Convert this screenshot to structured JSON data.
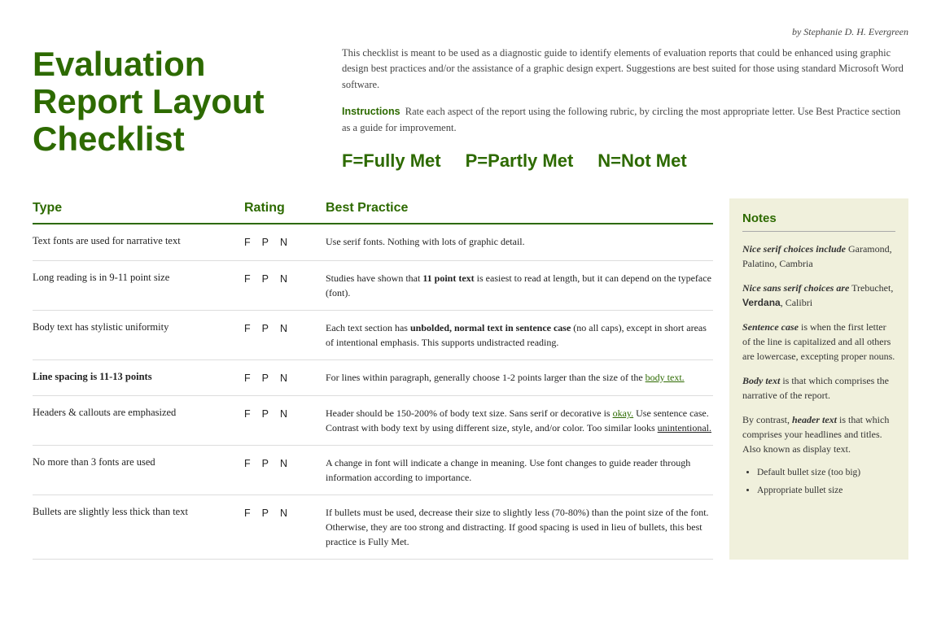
{
  "byline": "by Stephanie D. H. Evergreen",
  "title": {
    "line1": "Evaluation",
    "line2": "Report Layout",
    "line3": "Checklist"
  },
  "intro": {
    "description": "This checklist is meant to be used as a diagnostic guide to identify elements of evaluation reports that could be enhanced using graphic design best practices and/or the assistance of a graphic design expert. Suggestions are best suited for those using standard Microsoft Word software.",
    "instructions_label": "Instructions",
    "instructions_text": "Rate each aspect of the report using the following rubric, by circling the most appropriate letter. Use Best Practice section as a guide for improvement."
  },
  "legend": {
    "fully_met": "F=Fully Met",
    "partly_met": "P=Partly Met",
    "not_met": "N=Not Met"
  },
  "table": {
    "headers": {
      "type": "Type",
      "rating": "Rating",
      "best_practice": "Best Practice"
    },
    "rows": [
      {
        "label": "Text fonts are used for narrative text",
        "ratings": [
          "F",
          "P",
          "N"
        ],
        "practice": "Use serif fonts. Nothing with lots of graphic detail."
      },
      {
        "label": "Long reading is in 9-11 point size",
        "ratings": [
          "F",
          "P",
          "N"
        ],
        "practice": "Studies have shown that 11 point text is easiest to read at length, but it can depend on the typeface (font)."
      },
      {
        "label": "Body text has stylistic uniformity",
        "ratings": [
          "F",
          "P",
          "N"
        ],
        "practice": "Each text section has unbolded, normal text in sentence case (no all caps), except in short areas of intentional emphasis. This supports undistracted reading."
      },
      {
        "label": "Line spacing is 11-13 points",
        "ratings": [
          "F",
          "P",
          "N"
        ],
        "practice": "For lines within paragraph, generally choose 1-2 points larger than the size of the body text."
      },
      {
        "label": "Headers & callouts are emphasized",
        "ratings": [
          "F",
          "P",
          "N"
        ],
        "practice": "Header should be 150-200% of body text size. Sans serif or decorative is okay. Use sentence case. Contrast with body text by using different size, style, and/or color. Too similar looks unintentional."
      },
      {
        "label": "No more than 3 fonts are used",
        "ratings": [
          "F",
          "P",
          "N"
        ],
        "practice": "A change in font will indicate a change in meaning. Use font changes to guide reader through information according to importance."
      },
      {
        "label": "Bullets are slightly less thick than text",
        "ratings": [
          "F",
          "P",
          "N"
        ],
        "practice": "If bullets must be used, decrease their size to slightly less (70-80%) than the point size of the font. Otherwise, they are too strong and distracting. If good spacing is used in lieu of bullets, this best practice is Fully Met."
      }
    ]
  },
  "notes": {
    "header": "Notes",
    "items": [
      {
        "id": "serif-choices",
        "text_before": "Nice serif choices include",
        "text_after": "Garamond, Palatino, Cambria"
      },
      {
        "id": "sans-serif-choices",
        "text_before": "Nice sans serif choices are",
        "text_after": "Trebuchet, Verdana, Calibri"
      },
      {
        "id": "sentence-case",
        "text_before": "Sentence case",
        "text_after": "is when the first letter of the line is capitalized and all others are lowercase, excepting proper nouns."
      },
      {
        "id": "body-text",
        "text_before": "Body text",
        "text_after": "is that which comprises the narrative of the report."
      },
      {
        "id": "header-text",
        "text_before": "By contrast, header text is that which comprises your headlines and titles. Also known as display text."
      },
      {
        "id": "bullets",
        "bullet1": "Default bullet size (too big)",
        "bullet2": "Appropriate bullet size"
      }
    ]
  }
}
